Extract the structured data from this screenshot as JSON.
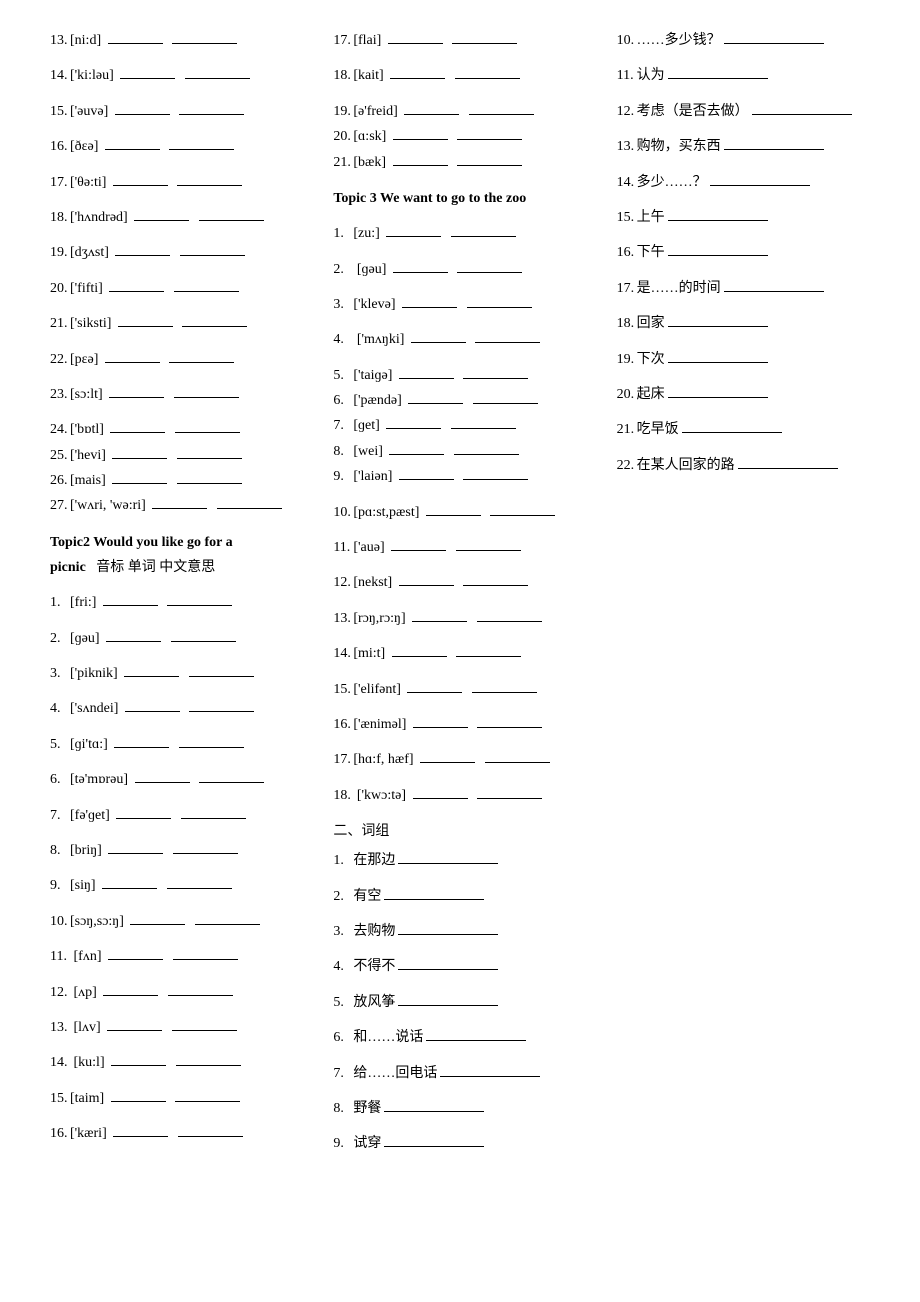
{
  "col1": {
    "items_a": [
      {
        "n": "13.",
        "ipa": "[ni:d]"
      },
      {
        "n": "14.",
        "ipa": "['ki:ləu]"
      },
      {
        "n": "15.",
        "ipa": "['əuvə]"
      },
      {
        "n": "16.",
        "ipa": "[ðɛə]"
      },
      {
        "n": "17.",
        "ipa": "['θə:ti]"
      },
      {
        "n": "18.",
        "ipa": "['hʌndrəd]"
      },
      {
        "n": "19.",
        "ipa": "[dʒʌst]"
      },
      {
        "n": "20.",
        "ipa": "['fifti]"
      },
      {
        "n": "21.",
        "ipa": "['siksti]"
      },
      {
        "n": "22.",
        "ipa": "[pɛə]"
      },
      {
        "n": "23.",
        "ipa": "[sɔ:lt]"
      }
    ],
    "items_tight": [
      {
        "n": "24.",
        "ipa": "['bɒtl]"
      },
      {
        "n": "25.",
        "ipa": "['hevi]"
      },
      {
        "n": "26.",
        "ipa": "[mais]"
      },
      {
        "n": "27.",
        "ipa": "['wʌri, 'wə:ri]"
      }
    ],
    "topic2_header": "Topic2 Would you like go for a",
    "topic2_header2": "picnic",
    "topic2_hdr_cols": "音标    单词    中文意思",
    "items_b": [
      {
        "n": "1.",
        "ipa": "[fri:]"
      },
      {
        "n": "2.",
        "ipa": "[ɡəu]"
      },
      {
        "n": "3.",
        "ipa": "['piknik]"
      },
      {
        "n": "4.",
        "ipa": "['sʌndei]"
      },
      {
        "n": "5.",
        "ipa": "[ɡi'tɑ:]"
      },
      {
        "n": "6.",
        "ipa": "[tə'mɒrəu]"
      },
      {
        "n": "7.",
        "ipa": "[fə'ɡet]"
      },
      {
        "n": "8.",
        "ipa": "[briŋ]"
      },
      {
        "n": "9.",
        "ipa": "[siŋ]"
      },
      {
        "n": "10.",
        "ipa": "[sɔŋ,sɔ:ŋ]"
      },
      {
        "n": "11.",
        "ipa": " [fʌn]"
      },
      {
        "n": "12.",
        "ipa": " [ʌp]"
      },
      {
        "n": "13.",
        "ipa": " [lʌv]"
      },
      {
        "n": "14.",
        "ipa": " [ku:l]"
      },
      {
        "n": "15.",
        "ipa": "[taim]"
      },
      {
        "n": "16.",
        "ipa": "['kæri]"
      }
    ]
  },
  "col2": {
    "items_a": [
      {
        "n": "17.",
        "ipa": "[flai]"
      },
      {
        "n": "18.",
        "ipa": "[kait]"
      }
    ],
    "items_tight1": [
      {
        "n": "19.",
        "ipa": "[ə'freid]"
      },
      {
        "n": "20.",
        "ipa": "[ɑ:sk]"
      },
      {
        "n": "21.",
        "ipa": "[bæk]"
      }
    ],
    "topic3_header": "Topic 3    We want to go to the zoo",
    "items_b": [
      {
        "n": "1.",
        "ipa": "[zu:]"
      },
      {
        "n": "2.",
        "ipa": " [ɡəu]"
      },
      {
        "n": "3.",
        "ipa": "['klevə]"
      },
      {
        "n": "4.",
        "ipa": " ['mʌŋki]"
      }
    ],
    "items_tight2": [
      {
        "n": "5.",
        "ipa": "['taiɡə]"
      },
      {
        "n": "6.",
        "ipa": "['pændə]"
      },
      {
        "n": "7.",
        "ipa": "[ɡet]"
      },
      {
        "n": "8.",
        "ipa": "[wei]"
      }
    ],
    "items_c": [
      {
        "n": "9.",
        "ipa": "['laiən]"
      },
      {
        "n": "10.",
        "ipa": "[pɑ:st,pæst]"
      },
      {
        "n": "11.",
        "ipa": "['auə]"
      },
      {
        "n": "12.",
        "ipa": "[nekst]"
      },
      {
        "n": "13.",
        "ipa": "[rɔŋ,rɔ:ŋ]"
      },
      {
        "n": "14.",
        "ipa": "[mi:t]"
      },
      {
        "n": "15.",
        "ipa": "['elifənt]"
      },
      {
        "n": "16.",
        "ipa": "['æniməl]"
      },
      {
        "n": "17.",
        "ipa": "[hɑ:f, hæf]"
      },
      {
        "n": "18.",
        "ipa": " ['kwɔ:tə]"
      }
    ],
    "phrases_header": "二、词组",
    "phrases": [
      {
        "n": "1.",
        "t": "在那边"
      },
      {
        "n": "2.",
        "t": "有空"
      },
      {
        "n": "3.",
        "t": "去购物"
      },
      {
        "n": "4.",
        "t": "不得不"
      },
      {
        "n": "5.",
        "t": "放风筝"
      },
      {
        "n": "6.",
        "t": "和……说话"
      },
      {
        "n": "7.",
        "t": "给……回电话"
      },
      {
        "n": "8.",
        "t": "野餐"
      },
      {
        "n": "9.",
        "t": "试穿"
      }
    ]
  },
  "col3": {
    "phrases": [
      {
        "n": "10.",
        "t": "……多少钱？"
      },
      {
        "n": "11.",
        "t": "认为"
      },
      {
        "n": "12.",
        "t": "考虑（是否去做）"
      },
      {
        "n": "13.",
        "t": "购物，买东西"
      },
      {
        "n": "14.",
        "t": "多少……？"
      },
      {
        "n": "15.",
        "t": "上午"
      },
      {
        "n": "16.",
        "t": "下午"
      },
      {
        "n": "17.",
        "t": "是……的时间"
      },
      {
        "n": "18.",
        "t": "回家"
      },
      {
        "n": "19.",
        "t": "下次"
      },
      {
        "n": "20.",
        "t": "起床"
      },
      {
        "n": "21.",
        "t": "吃早饭"
      },
      {
        "n": "22.",
        "t": "在某人回家的路"
      }
    ]
  }
}
